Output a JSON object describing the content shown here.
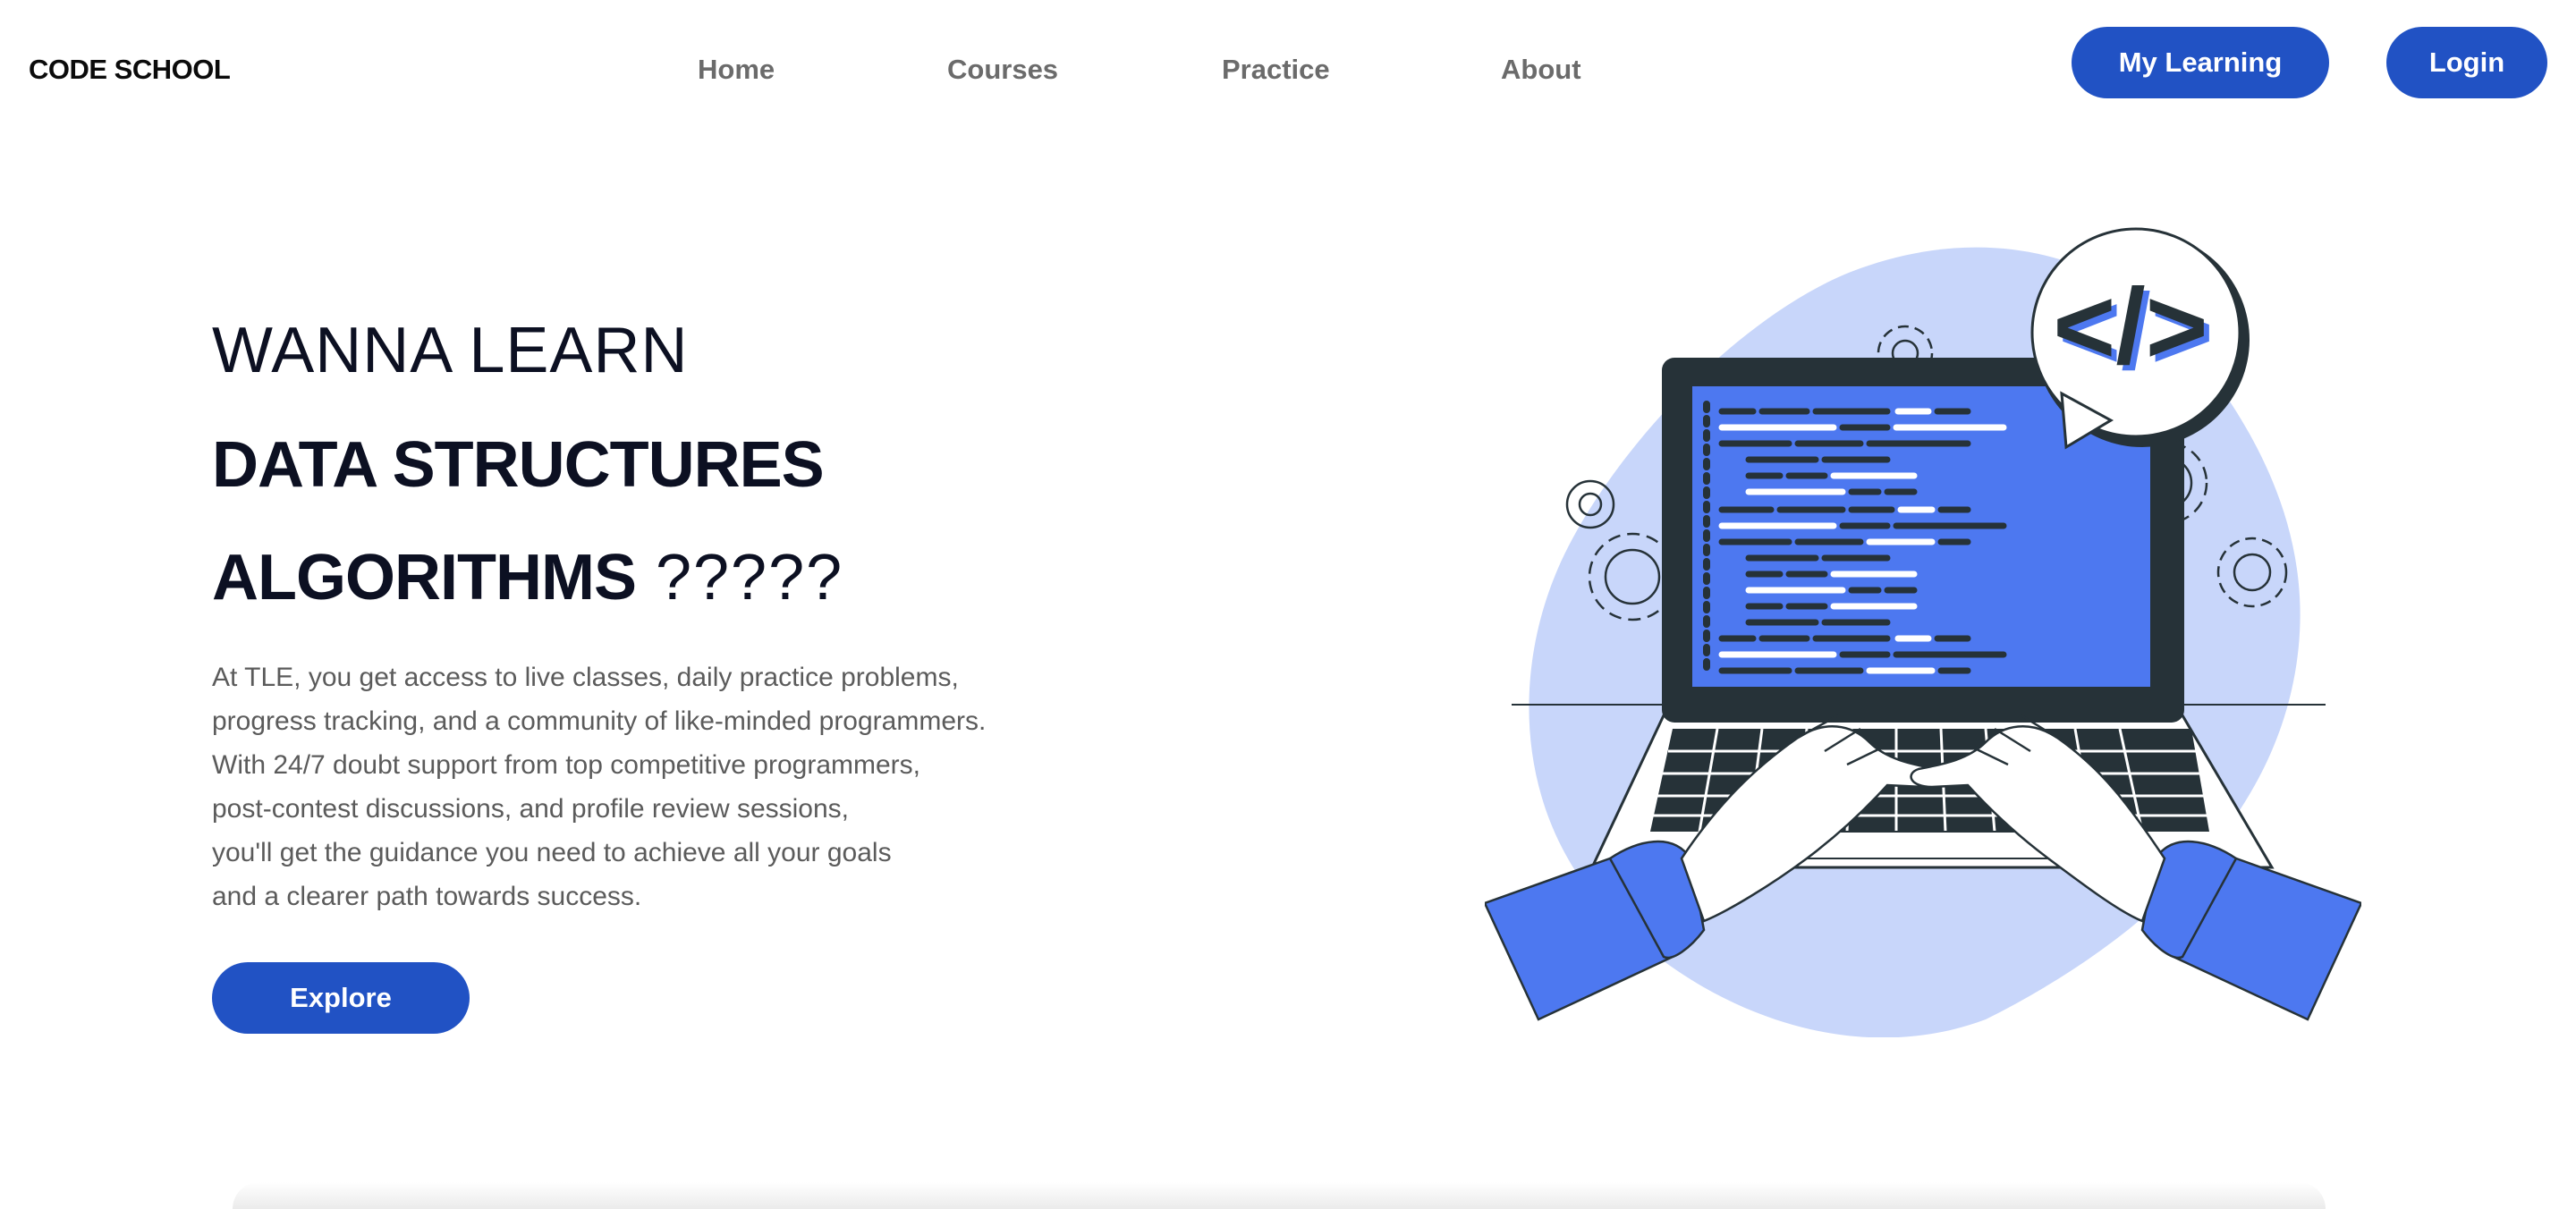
{
  "header": {
    "logo": "CODE SCHOOL",
    "nav": [
      {
        "label": "Home"
      },
      {
        "label": "Courses"
      },
      {
        "label": "Practice"
      },
      {
        "label": "About"
      }
    ],
    "my_learning_label": "My Learning",
    "login_label": "Login"
  },
  "hero": {
    "line1": "WANNA LEARN",
    "line2": "DATA STRUCTURES",
    "line3_bold": "ALGORITHMS",
    "line3_suffix": " ?????",
    "description_lines": [
      "At TLE, you get access to live classes, daily practice problems,",
      "progress tracking, and a community of like-minded programmers.",
      "With 24/7 doubt support from top competitive programmers,",
      "post-contest discussions, and profile review sessions,",
      "you'll get the guidance you need to achieve all your goals",
      "and a clearer path towards success."
    ],
    "explore_label": "Explore"
  },
  "illustration": {
    "code_symbol": "</>",
    "icons": [
      "laptop-icon",
      "code-bubble-icon",
      "gear-icon",
      "hands-typing-icon"
    ]
  },
  "colors": {
    "primary": "#2152c4",
    "accent_blue": "#4d78f0",
    "blob": "#c8d6fa",
    "dark": "#263238",
    "nav_text": "#6b6b6b",
    "heading": "#0c1022"
  }
}
